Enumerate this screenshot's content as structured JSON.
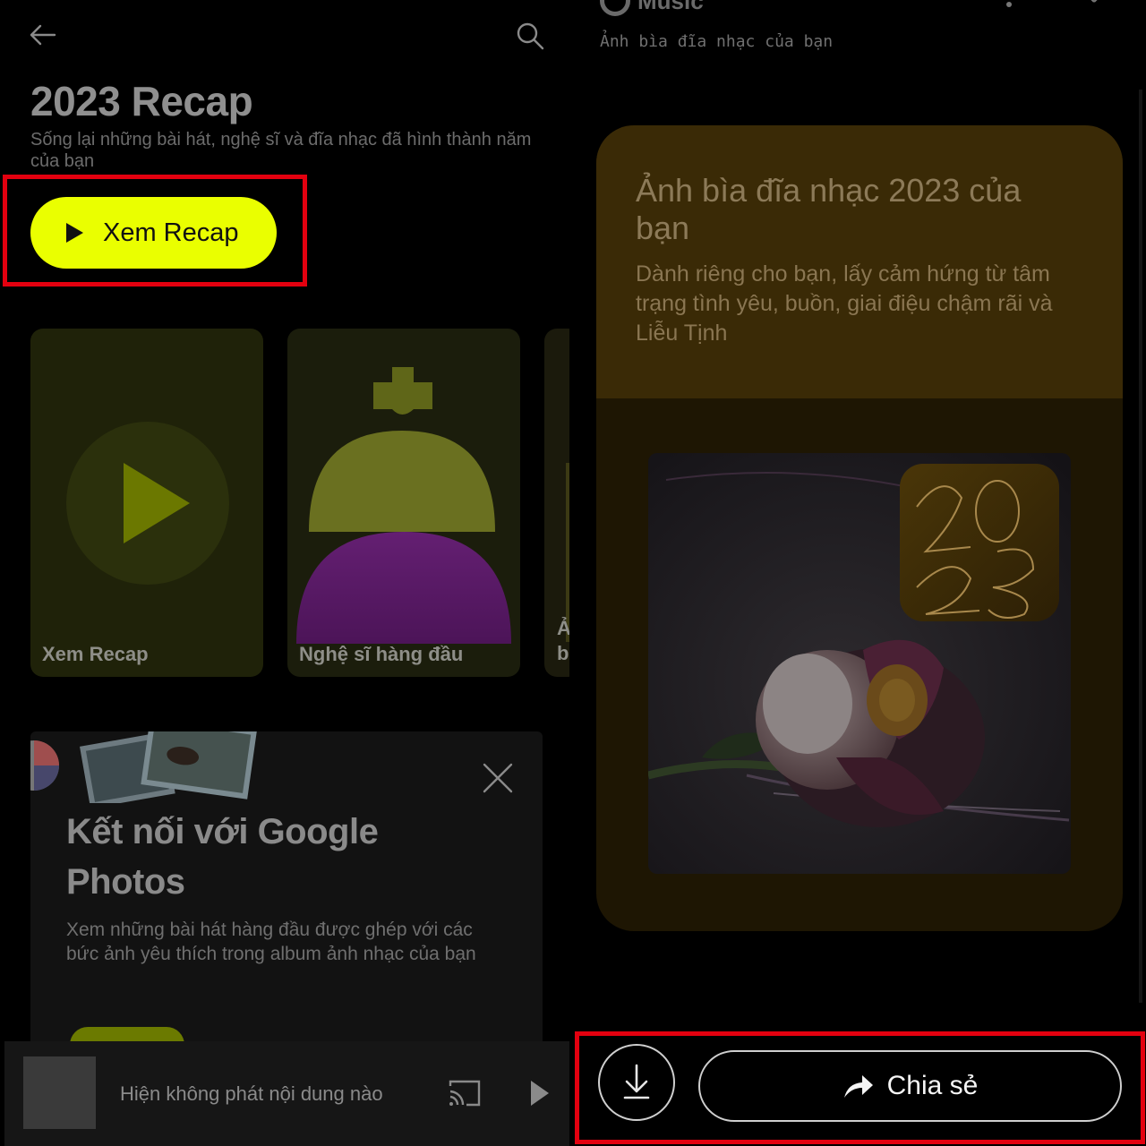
{
  "left_panel": {
    "header": {
      "back_icon": "arrow-left-icon",
      "search_icon": "search-icon"
    },
    "title": "2023 Recap",
    "subtitle": "Sống lại những bài hát, nghệ sĩ và đĩa nhạc đã hình thành năm của bạn",
    "primary_button": {
      "label": "Xem Recap",
      "icon": "play-icon",
      "color": "#eaff00"
    },
    "cards": [
      {
        "label": "Xem Recap",
        "icon": "play-circle-icon"
      },
      {
        "label": "Nghệ sĩ hàng đầu",
        "icon": "artist-shape-icon"
      },
      {
        "label": "Ả b"
      }
    ],
    "google_photos_card": {
      "title": "Kết nối với Google Photos",
      "body": "Xem những bài hát hàng đầu được ghép với các bức ảnh yêu thích trong album ảnh nhạc của bạn",
      "close_icon": "close-icon"
    },
    "mini_player": {
      "status_text": "Hiện không phát nội dung nào",
      "cast_icon": "cast-icon",
      "play_icon": "play-icon"
    }
  },
  "right_panel": {
    "app_name": "Music",
    "subtitle": "Ảnh bìa đĩa nhạc của bạn",
    "cover_card": {
      "title": "Ảnh bìa đĩa nhạc 2023 của bạn",
      "description": "Dành riêng cho bạn, lấy cảm hứng từ tâm trạng tình yêu, buồn, giai điệu chậm rãi và Liễu Tịnh",
      "album_badge": "2023"
    },
    "actions": {
      "download_icon": "download-icon",
      "share_label": "Chia sẻ",
      "share_icon": "share-arrow-icon"
    }
  },
  "colors": {
    "highlight": "#e3000f",
    "accent": "#eaff00"
  }
}
